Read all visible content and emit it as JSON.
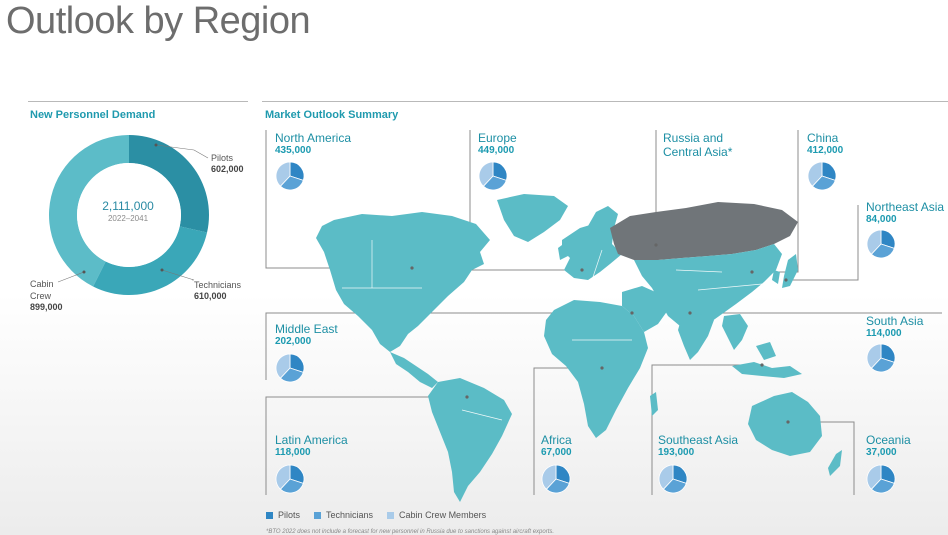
{
  "page_title": "Outlook by Region",
  "personnel": {
    "heading": "New Personnel Demand",
    "total": "2,111,000",
    "period": "2022–2041",
    "segments": [
      {
        "label": "Pilots",
        "value": "602,000",
        "amount": 602000,
        "color": "#2b8fa4"
      },
      {
        "label": "Technicians",
        "value": "610,000",
        "amount": 610000,
        "color": "#3aa7b8"
      },
      {
        "label": "Cabin\nCrew",
        "value": "899,000",
        "amount": 899000,
        "color": "#5cbcc8"
      }
    ]
  },
  "market": {
    "heading": "Market Outlook Summary",
    "map_colors": {
      "land": "#5bbcc6",
      "russia": "#707579",
      "borders": "#ffffff"
    },
    "regions": [
      {
        "name": "North America",
        "value": "435,000"
      },
      {
        "name": "Europe",
        "value": "449,000"
      },
      {
        "name": "Russia and Central Asia*",
        "value": ""
      },
      {
        "name": "China",
        "value": "412,000"
      },
      {
        "name": "Northeast Asia",
        "value": "84,000"
      },
      {
        "name": "Middle East",
        "value": "202,000"
      },
      {
        "name": "South Asia",
        "value": "114,000"
      },
      {
        "name": "Latin America",
        "value": "118,000"
      },
      {
        "name": "Africa",
        "value": "67,000"
      },
      {
        "name": "Southeast Asia",
        "value": "193,000"
      },
      {
        "name": "Oceania",
        "value": "37,000"
      }
    ]
  },
  "legend": [
    {
      "label": "Pilots",
      "color": "#2f86c4"
    },
    {
      "label": "Technicians",
      "color": "#5aa2d6"
    },
    {
      "label": "Cabin Crew Members",
      "color": "#a9cbe9"
    }
  ],
  "footnote": "*BTO 2022 does not include a forecast for new personnel in Russia due to sanctions against aircraft exports."
}
